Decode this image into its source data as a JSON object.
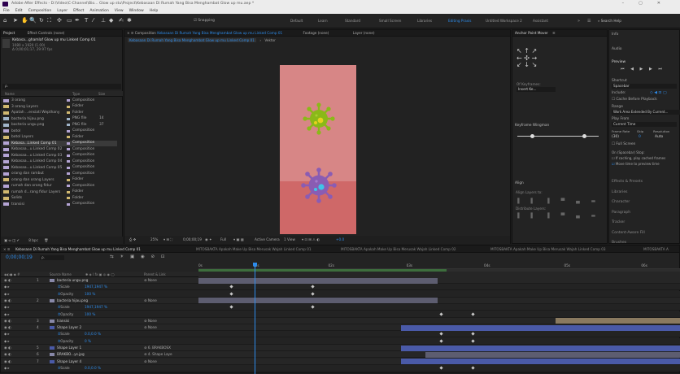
{
  "window": {
    "title": "Adobe After Effects - D:\\Video\\C-Channel\\Bio... Glow up stu\\Project\\Kebasaan Di Rumah Yang Bisa Menghambat Glow up mu.aep *"
  },
  "menubar": [
    "File",
    "Edit",
    "Composition",
    "Layer",
    "Effect",
    "Animation",
    "View",
    "Window",
    "Help"
  ],
  "toolbar": {
    "snapping": "Snapping",
    "workspaces": [
      "Default",
      "Learn",
      "Standard",
      "Small Screen",
      "Libraries",
      "Editing Praxis",
      "Untitled Workspace 2",
      "Assistant"
    ],
    "active_workspace": "Editing Praxis",
    "search": "Search Help"
  },
  "project": {
    "tab": "Project",
    "effect_tab": "Effect Controls (none)",
    "item_name": "Kebasa...ghamlaf Glow up mu Linked Comp 01",
    "item_size": "1080 x 1920 (1.00)",
    "item_dur": "Δ 0;00;01;17, 29.97 fps",
    "search_placeholder": "ρ.",
    "columns": [
      "Name",
      "Type",
      "Size"
    ],
    "items": [
      {
        "name": "3 orang",
        "type": "Composition",
        "size": "",
        "color": "#b4a4d4"
      },
      {
        "name": "3 orang Layers",
        "type": "Folder",
        "size": "",
        "color": "#d0b870"
      },
      {
        "name": "Apatah ...ensiati Wepthany",
        "type": "Folder",
        "size": "",
        "color": "#d0b870"
      },
      {
        "name": "bacteria hijau.png",
        "type": "PNG file",
        "size": "14",
        "color": "#a0b4c8"
      },
      {
        "name": "bacteria ungu.png",
        "type": "PNG file",
        "size": "37",
        "color": "#a0b4c8"
      },
      {
        "name": "botol",
        "type": "Composition",
        "size": "",
        "color": "#b4a4d4"
      },
      {
        "name": "botol Layers",
        "type": "Folder",
        "size": "",
        "color": "#d0b870"
      },
      {
        "name": "Kebasa...Linked Comp 01",
        "type": "Composition",
        "size": "",
        "color": "#b4a4d4"
      },
      {
        "name": "Kebasaa...u Linked Comp 02",
        "type": "Composition",
        "size": "",
        "color": "#b4a4d4"
      },
      {
        "name": "Kebasaa...u Linked Comp 03",
        "type": "Composition",
        "size": "",
        "color": "#b4a4d4"
      },
      {
        "name": "Kebasaa...u Linked Comp 04",
        "type": "Composition",
        "size": "",
        "color": "#b4a4d4"
      },
      {
        "name": "Kebasaa...u Linked Comp 05",
        "type": "Composition",
        "size": "",
        "color": "#b4a4d4"
      },
      {
        "name": "orang dan rambut",
        "type": "Composition",
        "size": "",
        "color": "#b4a4d4"
      },
      {
        "name": "orang dan orang Layers",
        "type": "Folder",
        "size": "",
        "color": "#d0b870"
      },
      {
        "name": "rumah dan orang fidur",
        "type": "Composition",
        "size": "",
        "color": "#b4a4d4"
      },
      {
        "name": "rumah d...rang fidur Layers",
        "type": "Folder",
        "size": "",
        "color": "#d0b870"
      },
      {
        "name": "Solids",
        "type": "Folder",
        "size": "",
        "color": "#d0b870"
      },
      {
        "name": "transisi",
        "type": "Composition",
        "size": "",
        "color": "#b4a4d4"
      }
    ],
    "bpc": "8 bpc"
  },
  "composition": {
    "tab": "Composition",
    "comp_name": "Kebasaan Di Rumah Yang Bisa Menghambat Glow up mu Linked Comp 01",
    "footage_tab": "Footage (none)",
    "layer_tab": "Layer (none)",
    "breadcrumb": "Kebasaan Di Rumah Yang Bisa Menghambat Glow up mu Linked Comp 01",
    "breadcrumb2": "Vektor",
    "viewer_bar": {
      "zoom": "25%",
      "timecode": "0;00;00;19",
      "quality": "Full",
      "camera": "Active Camera",
      "views": "1 View",
      "exposure": "+0.0"
    }
  },
  "anchor": {
    "tab": "Anchor Point Mover",
    "keyframe_label": "Keyframe Wingman",
    "align_tab": "Align",
    "align_layers": "Align Layers to:",
    "distribute": "Distribute Layers:",
    "selected_label": "Of Keyframes:",
    "insert": "Insert Ke..."
  },
  "right": {
    "info": "Info",
    "audio": "Audio",
    "preview": "Preview",
    "shortcut": "Shortcut",
    "shortcut_val": "Spacebar",
    "include": "Include:",
    "cache": "Cache Before Playback",
    "range": "Range",
    "range_val": "Work Area Extended By Current...",
    "play_from": "Play From",
    "play_from_val": "Current Time",
    "frame_rate": "Frame Rate",
    "skip": "Skip",
    "resolution": "Resolution",
    "fr_val": "(30)",
    "skip_val": "0",
    "res_val": "Auto",
    "full_screen": "Full Screen",
    "on_stop": "On (Spacebar) Stop:",
    "if_caching": "If caching, play cached frames",
    "move_time": "Move time to preview time",
    "panels": [
      "Effects & Presets",
      "Libraries",
      "Character",
      "Paragraph",
      "Tracker",
      "Content-Aware Fill",
      "Brushes"
    ]
  },
  "timeline": {
    "tabs": [
      "Kebasaan Di Rumah Yang Bisa Menghambat Glow up mu Linked Comp 01",
      "MITOSBAKTA Apakah Make Up Bisa Merusak Wajah Linked Comp 01",
      "MITOSBAKTA Apakah Make Up Bisa Merusak Wajah Linked Comp 02",
      "MITOSBAKTA Apakah Make Up Bisa Merusak Wajah Linked Comp 03",
      "MITOSBAKTA A"
    ],
    "timecode": "0;00;00;19",
    "search": "ρ.",
    "columns": [
      "Source Name",
      "Parent & Link"
    ],
    "ruler": [
      "0s",
      "01s",
      "02s",
      "03s",
      "04s",
      "05s",
      "06s"
    ],
    "rows": [
      {
        "num": "1",
        "name": "bacteria ungu.png",
        "value": "",
        "parent": "None",
        "type": "layer",
        "bar": [
          0.0,
          0.495
        ],
        "barcolor": "#5d5d70"
      },
      {
        "num": "",
        "name": "Scale",
        "value": "1947,1947 %",
        "parent": "",
        "type": "prop"
      },
      {
        "num": "",
        "name": "Opacity",
        "value": "100 %",
        "parent": "",
        "type": "prop"
      },
      {
        "num": "2",
        "name": "bacteria hijau.png",
        "value": "",
        "parent": "None",
        "type": "layer",
        "bar": [
          0.0,
          0.495
        ],
        "barcolor": "#5d5d70"
      },
      {
        "num": "",
        "name": "Scale",
        "value": "1947,1947 %",
        "parent": "",
        "type": "prop"
      },
      {
        "num": "",
        "name": "Opacity",
        "value": "100 %",
        "parent": "",
        "type": "prop"
      },
      {
        "num": "3",
        "name": "transisi",
        "value": "",
        "parent": "None",
        "type": "layer",
        "bar": [
          0.74,
          1.0
        ],
        "barcolor": "#8a7a60"
      },
      {
        "num": "4",
        "name": "Shape Layer 2",
        "value": "",
        "parent": "None",
        "type": "layer",
        "bar": [
          0.42,
          1.0
        ],
        "barcolor": "#4a5aa8"
      },
      {
        "num": "",
        "name": "Scale",
        "value": "0.0,0.0 %",
        "parent": "",
        "type": "prop"
      },
      {
        "num": "",
        "name": "Opacity",
        "value": "0 %",
        "parent": "",
        "type": "prop"
      },
      {
        "num": "5",
        "name": "Shape Layer 1",
        "value": "",
        "parent": "6. BRAKBOSX",
        "type": "layer",
        "bar": [
          0.42,
          1.0
        ],
        "barcolor": "#4a5aa8"
      },
      {
        "num": "6",
        "name": "BRAKBO...ys.jpg",
        "value": "",
        "parent": "4. Shape Laye",
        "type": "layer",
        "bar": [
          0.47,
          1.0
        ],
        "barcolor": "#5d5d70"
      },
      {
        "num": "7",
        "name": "Shape Layer 4",
        "value": "",
        "parent": "None",
        "type": "layer",
        "bar": [
          0.42,
          1.0
        ],
        "barcolor": "#4a5aa8"
      },
      {
        "num": "",
        "name": "Scale",
        "value": "0.0,0.0 %",
        "parent": "",
        "type": "prop"
      }
    ]
  },
  "colors": {
    "accent": "#2d8ceb",
    "comp_bg_top": "#d88484",
    "comp_bg_bottom": "#d06a6a",
    "virus_green": "#8ab918",
    "virus_purple": "#8a5cb3"
  }
}
